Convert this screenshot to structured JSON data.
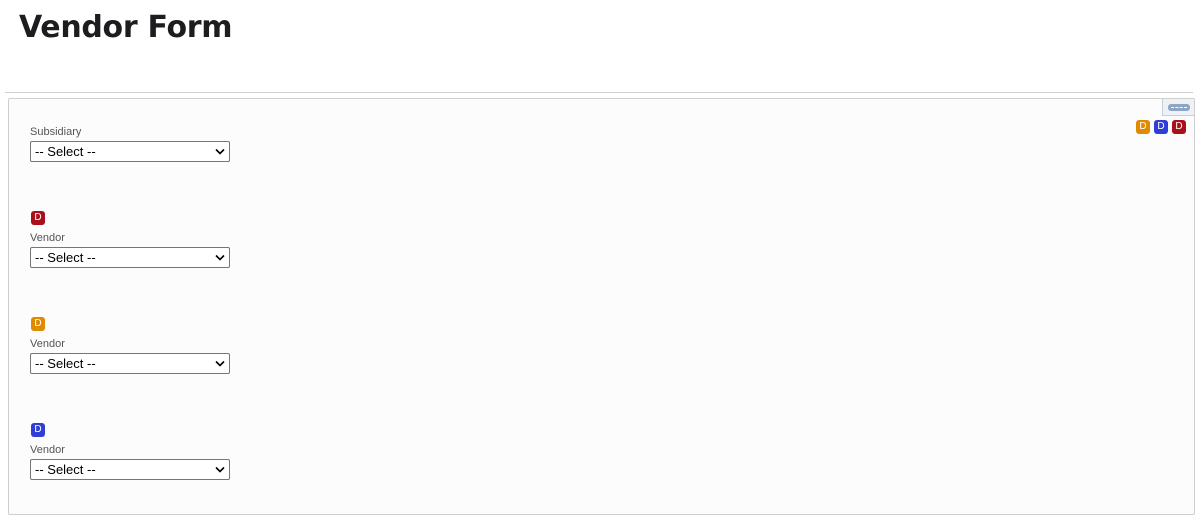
{
  "page": {
    "title": "Vendor Form"
  },
  "header_badges": [
    {
      "letter": "D",
      "color": "#e08a00"
    },
    {
      "letter": "D",
      "color": "#2f3fd6"
    },
    {
      "letter": "D",
      "color": "#a8101c"
    }
  ],
  "fields": [
    {
      "label": "Subsidiary",
      "value": "-- Select --"
    },
    {
      "label": "Vendor",
      "value": "-- Select --",
      "badge": {
        "letter": "D",
        "color": "#a8101c"
      }
    },
    {
      "label": "Vendor",
      "value": "-- Select --",
      "badge": {
        "letter": "D",
        "color": "#e08a00"
      }
    },
    {
      "label": "Vendor",
      "value": "-- Select --",
      "badge": {
        "letter": "D",
        "color": "#2f3fd6"
      }
    }
  ],
  "icons": {
    "handle": "drag-handle-icon",
    "chevron": "chevron-down-icon"
  }
}
